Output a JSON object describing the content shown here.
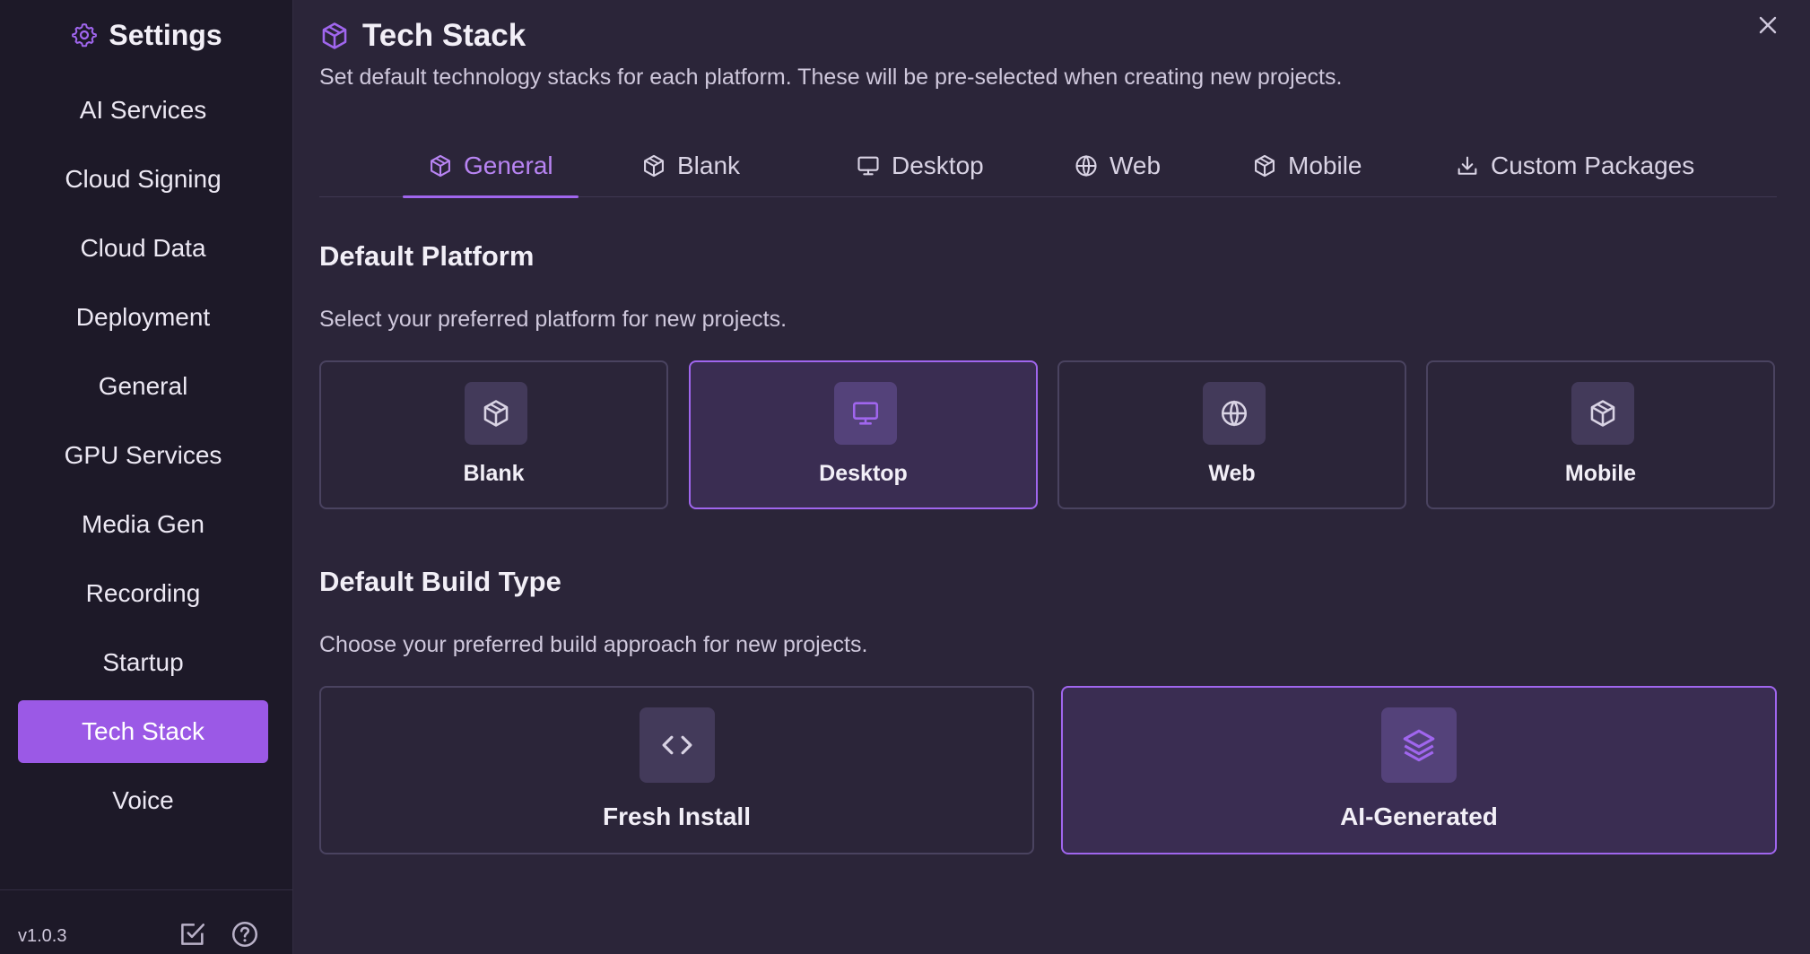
{
  "sidebar": {
    "title": "Settings",
    "items": [
      {
        "label": "AI Services",
        "active": false
      },
      {
        "label": "Cloud Signing",
        "active": false
      },
      {
        "label": "Cloud Data",
        "active": false
      },
      {
        "label": "Deployment",
        "active": false
      },
      {
        "label": "General",
        "active": false
      },
      {
        "label": "GPU Services",
        "active": false
      },
      {
        "label": "Media Gen",
        "active": false
      },
      {
        "label": "Recording",
        "active": false
      },
      {
        "label": "Startup",
        "active": false
      },
      {
        "label": "Tech Stack",
        "active": true
      },
      {
        "label": "Voice",
        "active": false
      }
    ],
    "version": "v1.0.3"
  },
  "header": {
    "title": "Tech Stack",
    "description": "Set default technology stacks for each platform. These will be pre-selected when creating new projects."
  },
  "tabs": [
    {
      "label": "General",
      "icon": "cube-icon",
      "active": true
    },
    {
      "label": "Blank",
      "icon": "cube-icon",
      "active": false
    },
    {
      "label": "Desktop",
      "icon": "monitor-icon",
      "active": false
    },
    {
      "label": "Web",
      "icon": "globe-icon",
      "active": false
    },
    {
      "label": "Mobile",
      "icon": "cube-icon",
      "active": false
    },
    {
      "label": "Custom Packages",
      "icon": "download-icon",
      "active": false
    }
  ],
  "platform": {
    "title": "Default Platform",
    "description": "Select your preferred platform for new projects.",
    "options": [
      {
        "label": "Blank",
        "icon": "cube-icon",
        "selected": false
      },
      {
        "label": "Desktop",
        "icon": "monitor-icon",
        "selected": true
      },
      {
        "label": "Web",
        "icon": "globe-icon",
        "selected": false
      },
      {
        "label": "Mobile",
        "icon": "cube-icon",
        "selected": false
      }
    ]
  },
  "build": {
    "title": "Default Build Type",
    "description": "Choose your preferred build approach for new projects.",
    "options": [
      {
        "label": "Fresh Install",
        "icon": "code-icon",
        "selected": false
      },
      {
        "label": "AI-Generated",
        "icon": "layers-icon",
        "selected": true
      }
    ]
  },
  "colors": {
    "accent": "#9b59e6",
    "accent_text": "#b884f3",
    "background": "#2b2539",
    "sidebar_bg": "#1d1928"
  }
}
